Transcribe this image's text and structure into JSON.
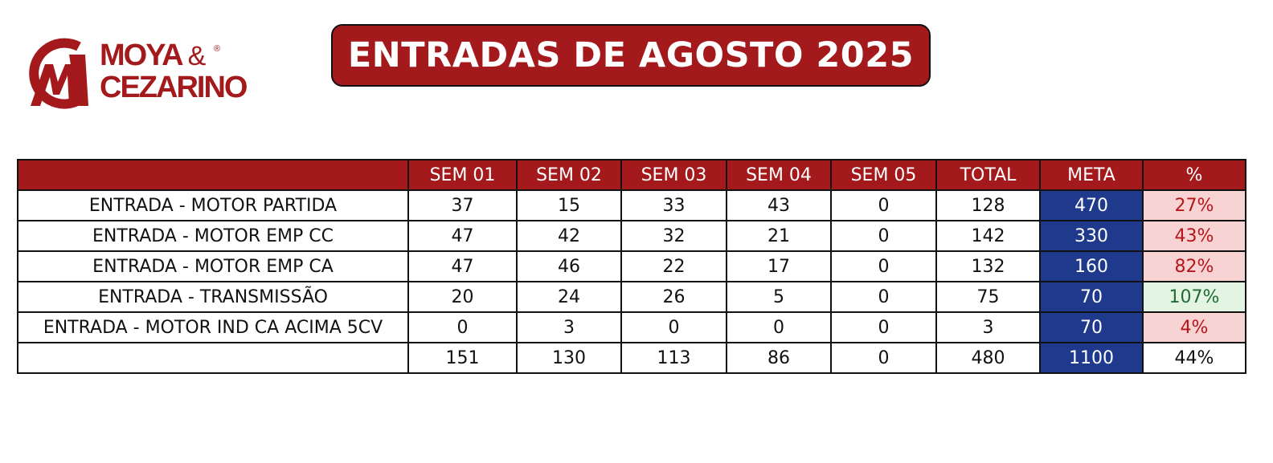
{
  "logo": {
    "line1": "MOYA",
    "amp": "&",
    "reg": "®",
    "line2": "CEZARINO",
    "color": "#a3191c"
  },
  "title": "ENTRADAS DE AGOSTO 2025",
  "table": {
    "columns": [
      "",
      "SEM 01",
      "SEM 02",
      "SEM 03",
      "SEM 04",
      "SEM 05",
      "TOTAL",
      "META",
      "%"
    ],
    "rows": [
      {
        "label": "ENTRADA - MOTOR PARTIDA",
        "sem01": "37",
        "sem02": "15",
        "sem03": "33",
        "sem04": "43",
        "sem05": "0",
        "total": "128",
        "meta": "470",
        "pct": "27%",
        "status": "below"
      },
      {
        "label": "ENTRADA - MOTOR EMP CC",
        "sem01": "47",
        "sem02": "42",
        "sem03": "32",
        "sem04": "21",
        "sem05": "0",
        "total": "142",
        "meta": "330",
        "pct": "43%",
        "status": "below"
      },
      {
        "label": "ENTRADA - MOTOR EMP CA",
        "sem01": "47",
        "sem02": "46",
        "sem03": "22",
        "sem04": "17",
        "sem05": "0",
        "total": "132",
        "meta": "160",
        "pct": "82%",
        "status": "below"
      },
      {
        "label": "ENTRADA - TRANSMISSÃO",
        "sem01": "20",
        "sem02": "24",
        "sem03": "26",
        "sem04": "5",
        "sem05": "0",
        "total": "75",
        "meta": "70",
        "pct": "107%",
        "status": "above"
      },
      {
        "label": "ENTRADA - MOTOR IND CA ACIMA 5CV",
        "sem01": "0",
        "sem02": "3",
        "sem03": "0",
        "sem04": "0",
        "sem05": "0",
        "total": "3",
        "meta": "70",
        "pct": "4%",
        "status": "below"
      }
    ],
    "totals": {
      "label": "",
      "sem01": "151",
      "sem02": "130",
      "sem03": "113",
      "sem04": "86",
      "sem05": "0",
      "total": "480",
      "meta": "1100",
      "pct": "44%"
    }
  },
  "colors": {
    "brand_red": "#a3191c",
    "meta_blue": "#1f3a8c",
    "pct_below_bg": "#f8d3d3",
    "pct_below_text": "#b5161b",
    "pct_above_bg": "#e4f4e3",
    "pct_above_text": "#1d6b35"
  }
}
